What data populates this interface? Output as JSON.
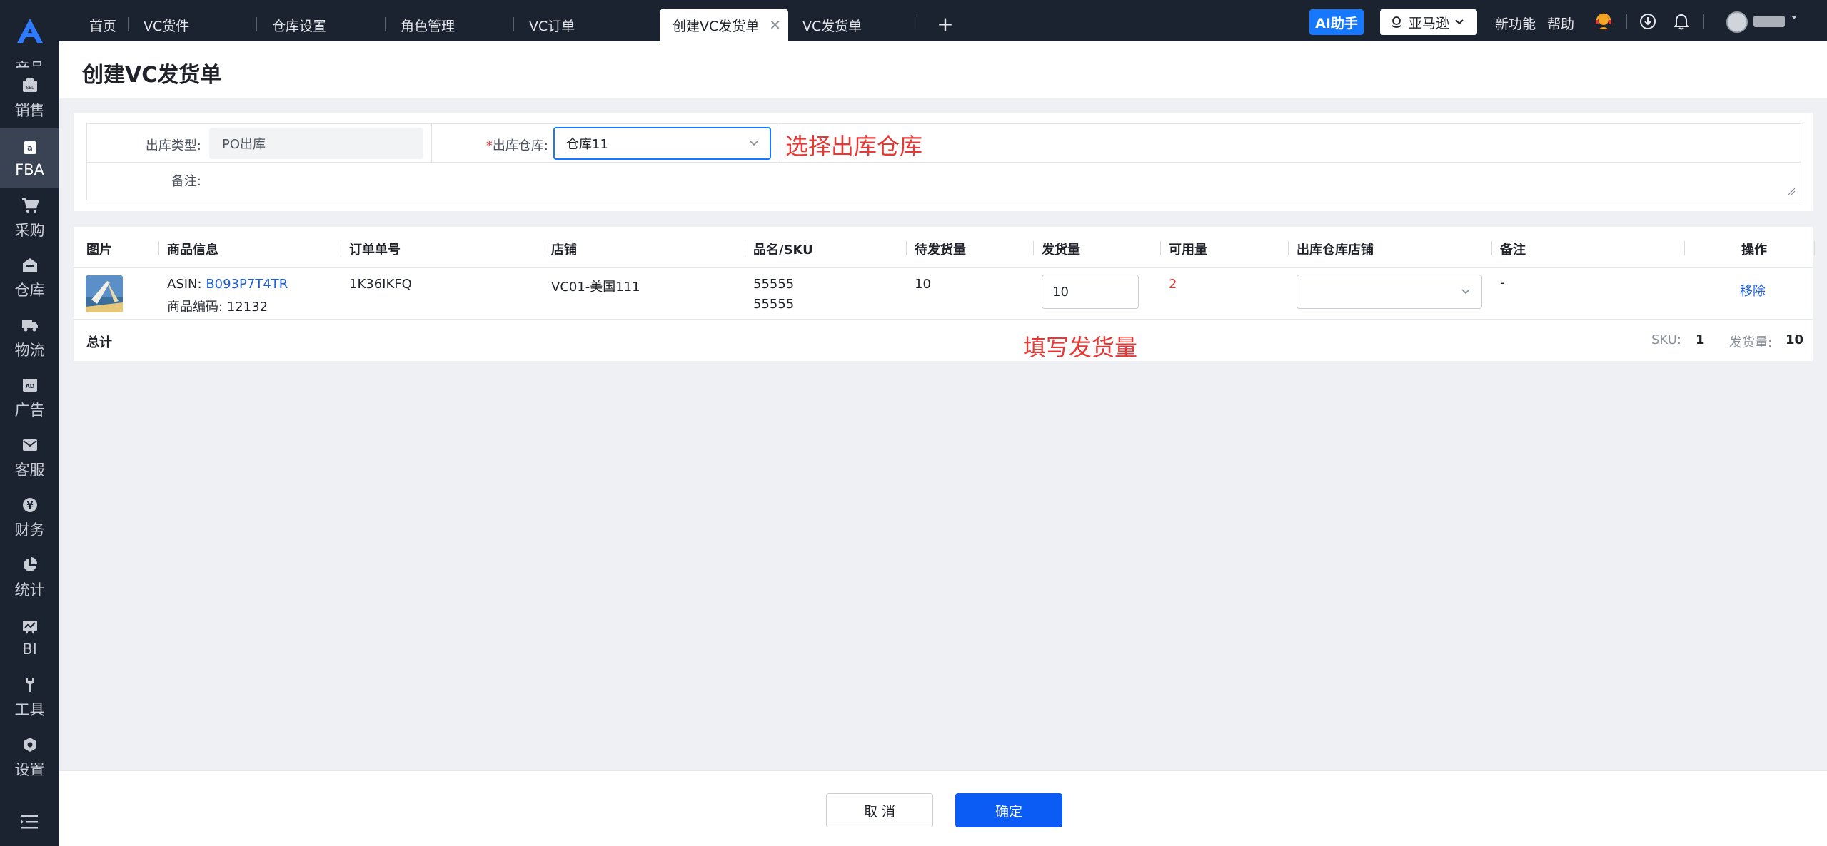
{
  "sidebar": {
    "logo": "app-logo",
    "items": [
      {
        "label": "产品",
        "icon": "product-icon"
      },
      {
        "label": "销售",
        "icon": "sales-icon"
      },
      {
        "label": "FBA",
        "icon": "amazon-icon"
      },
      {
        "label": "采购",
        "icon": "cart-icon"
      },
      {
        "label": "仓库",
        "icon": "warehouse-icon"
      },
      {
        "label": "物流",
        "icon": "truck-icon"
      },
      {
        "label": "广告",
        "icon": "ad-icon"
      },
      {
        "label": "客服",
        "icon": "mail-icon"
      },
      {
        "label": "财务",
        "icon": "finance-icon"
      },
      {
        "label": "统计",
        "icon": "pie-chart-icon"
      },
      {
        "label": "BI",
        "icon": "bi-icon"
      },
      {
        "label": "工具",
        "icon": "tool-icon"
      },
      {
        "label": "设置",
        "icon": "settings-icon"
      }
    ],
    "active_index": 2,
    "footer_icon": "collapse-menu-icon"
  },
  "topbar": {
    "tabs": [
      {
        "label": "首页"
      },
      {
        "label": "VC货件"
      },
      {
        "label": "仓库设置"
      },
      {
        "label": "角色管理"
      },
      {
        "label": "VC订单"
      },
      {
        "label": "创建VC发货单",
        "active": true
      },
      {
        "label": "VC发货单"
      }
    ],
    "close_glyph": "✕",
    "add_glyph": "+",
    "ai_button": "AI助手",
    "store_select": "亚马逊",
    "new_feature": "新功能",
    "help": "帮助",
    "icons": [
      "support-icon",
      "download-icon",
      "bell-icon"
    ]
  },
  "page": {
    "title": "创建VC发货单"
  },
  "form": {
    "out_type_label": "出库类型:",
    "out_type_value": "PO出库",
    "warehouse_required": "*",
    "warehouse_label": "出库仓库:",
    "warehouse_value": "仓库11",
    "remark_label": "备注:",
    "annotation": "选择出库仓库"
  },
  "table": {
    "columns": [
      "图片",
      "商品信息",
      "订单单号",
      "店铺",
      "品名/SKU",
      "待发货量",
      "发货量",
      "可用量",
      "出库仓库店铺",
      "备注",
      "操作"
    ],
    "rows": [
      {
        "asin_label": "ASIN:",
        "asin": "B093P7T4TR",
        "product_code_label": "商品编码:",
        "product_code": "12132",
        "order_no": "1K36IKFQ",
        "store": "VC01-美国111",
        "name": "55555",
        "sku": "55555",
        "pending_qty": "10",
        "ship_qty": "10",
        "available_qty": "2",
        "remark": "-",
        "action": "移除"
      }
    ],
    "total_label": "总计",
    "sku_label": "SKU:",
    "sku_count": "1",
    "ship_total_label": "发货量:",
    "ship_total": "10",
    "annotation": "填写发货量"
  },
  "actions": {
    "cancel": "取 消",
    "confirm": "确定"
  },
  "colors": {
    "sidebar_bg": "#1c2330",
    "primary": "#1677ff",
    "annotation_red": "#e53935",
    "link": "#1e5fd8"
  }
}
